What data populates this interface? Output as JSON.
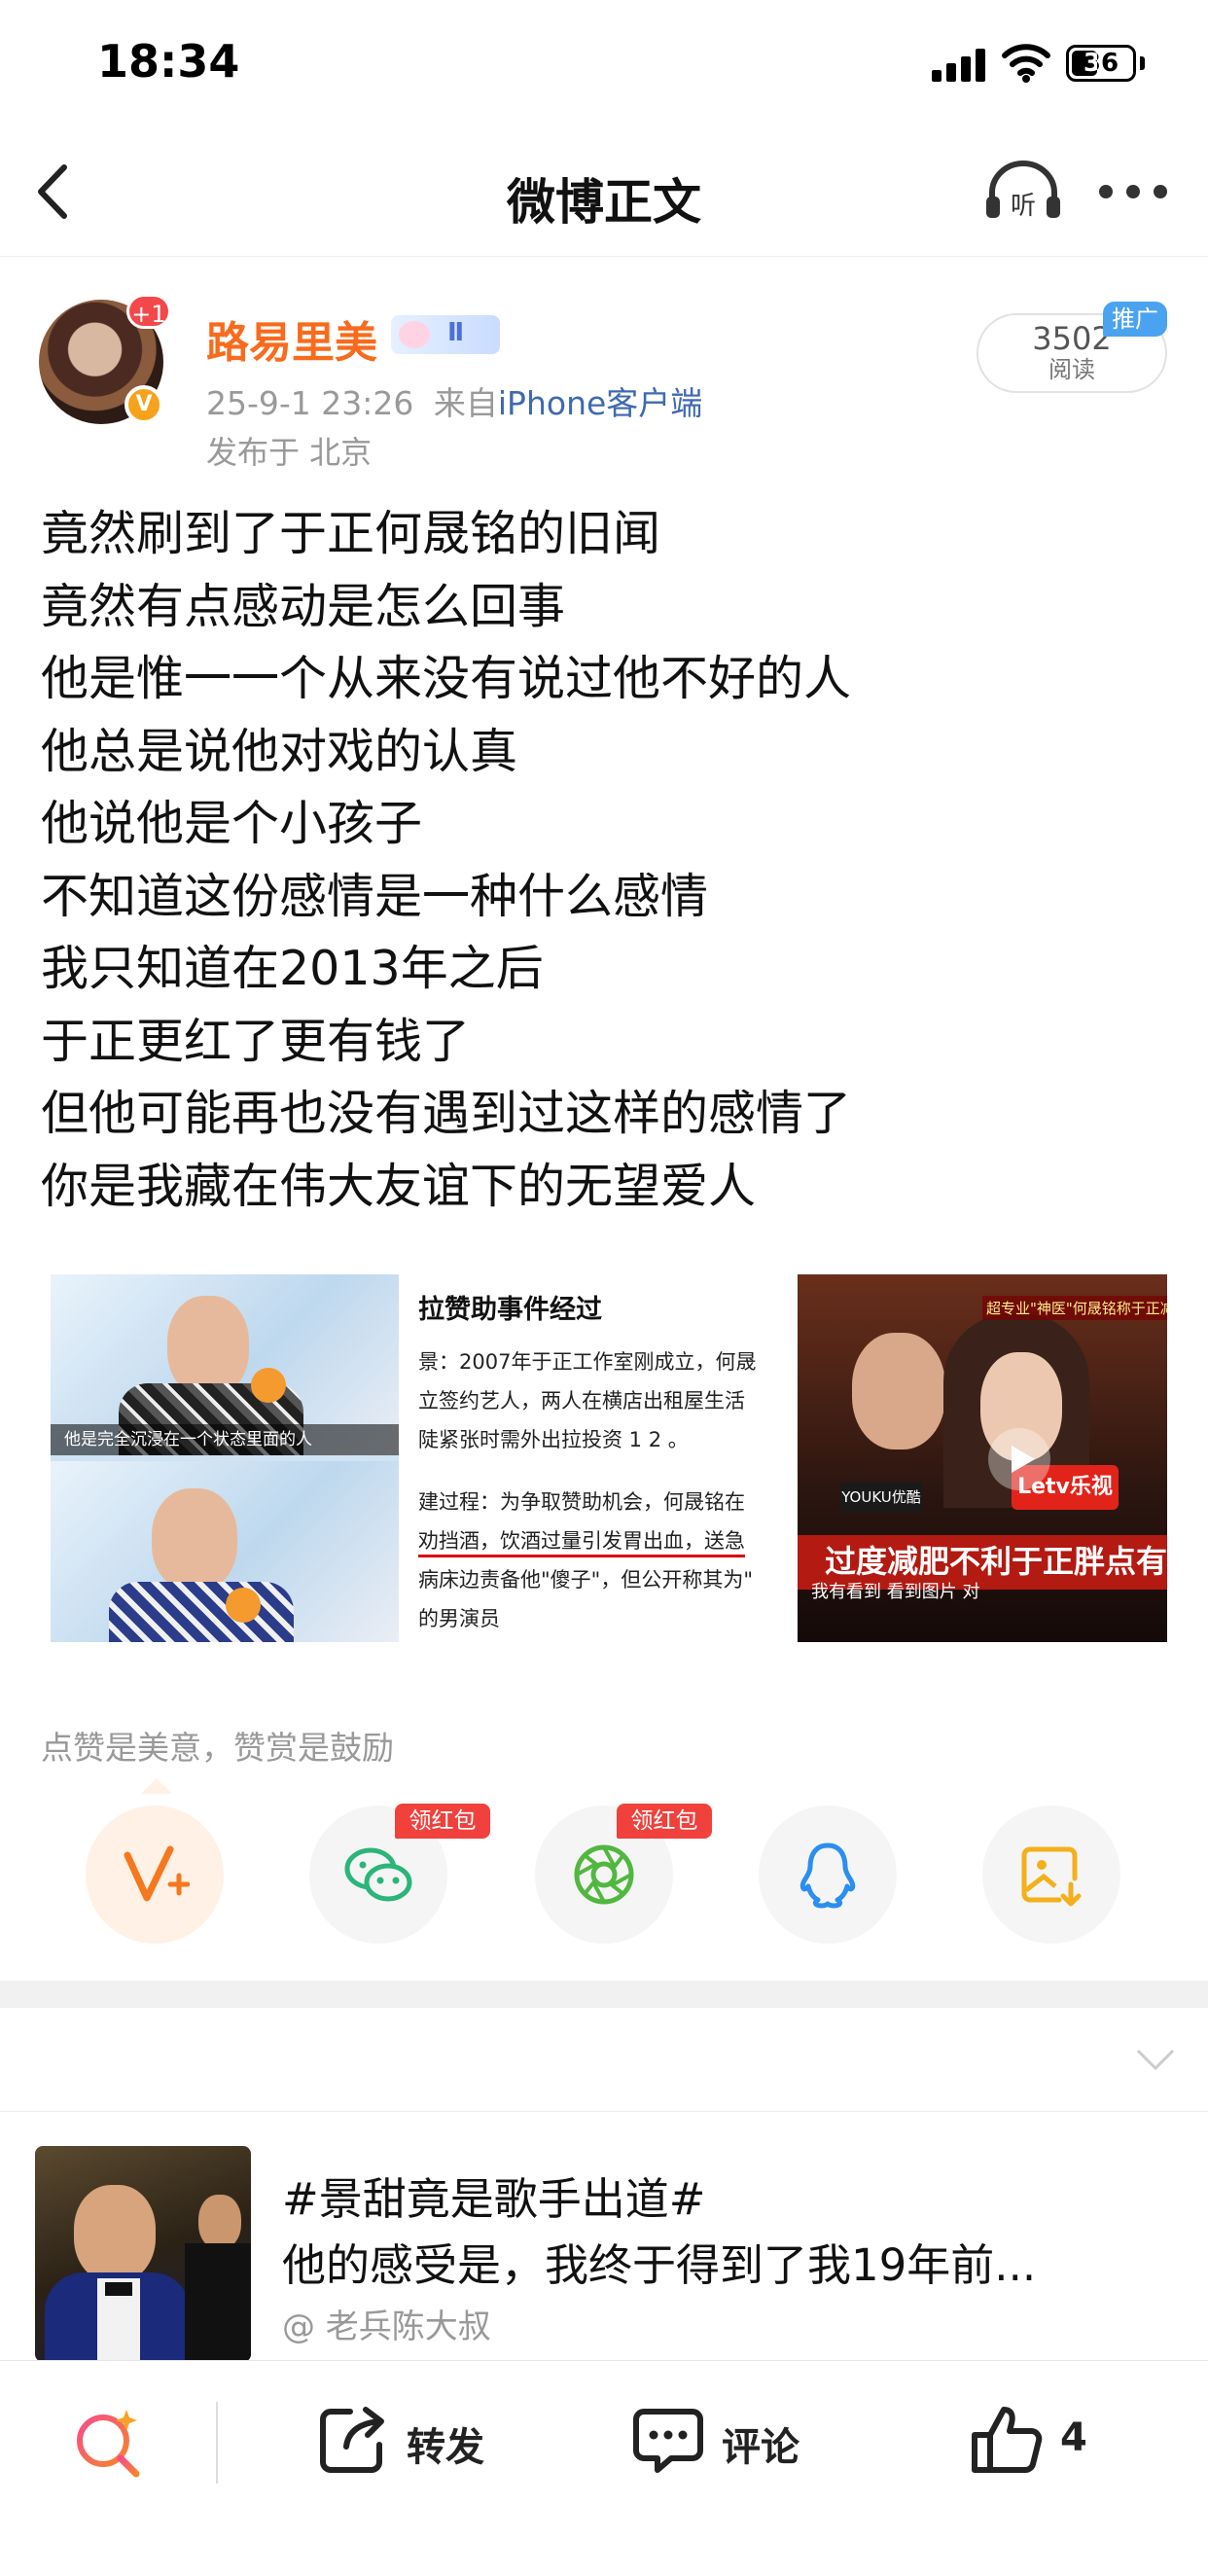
{
  "status_bar": {
    "time": "18:34",
    "battery": "36"
  },
  "nav": {
    "title": "微博正文"
  },
  "post": {
    "author": {
      "name": "路易里美",
      "avatar_badge": "+1",
      "verified_icon": "v-badge",
      "member_level": "Ⅱ"
    },
    "timestamp": "25-9-1 23:26",
    "source_prefix": "来自",
    "source": "iPhone客户端",
    "location": "发布于 北京",
    "read_count": "3502",
    "read_label": "阅读",
    "promo_tag": "推广",
    "lines": [
      "竟然刷到了于正何晟铭的旧闻",
      "竟然有点感动是怎么回事",
      "他是惟一一个从来没有说过他不好的人",
      "他总是说他对戏的认真",
      "他说他是个小孩子",
      "不知道这份感情是一种什么感情",
      "我只知道在2013年之后",
      "于正更红了更有钱了",
      "但他可能再也没有遇到过这样的感情了",
      "你是我藏在伟大友谊下的无望爱人"
    ],
    "images": {
      "img1_caption": "他是完全沉浸在一个状态里面的人",
      "img2_heading": "拉赞助事件经过",
      "img2_lines": [
        "景：2007年于正工作室刚成立，何晟",
        "立签约艺人，两人在横店出租屋生活",
        "陡紧张时需外出拉投资 1 2 。",
        "建过程：为争取赞助机会，何晟铭在",
        "劝挡酒，饮酒过量引发胃出血，送急",
        "病床边责备他\"傻子\"，但公开称其为\"",
        "的男演员"
      ],
      "img3_top": "超专业\"神医\"何晟铭称于正减",
      "img3_logo1": "YOUKU优酷",
      "img3_logo2": "Letv乐视",
      "img3_subtitle": "过度减肥不利于正胖点有福气",
      "img3_small": "我有看到 看到图片 对"
    }
  },
  "reward": {
    "hint": "点赞是美意，赞赏是鼓励",
    "red_packet_label": "领红包",
    "buttons": [
      {
        "icon": "reward-icon"
      },
      {
        "icon": "wechat-icon"
      },
      {
        "icon": "moments-icon"
      },
      {
        "icon": "qq-icon"
      },
      {
        "icon": "save-image-icon"
      }
    ]
  },
  "recommended": {
    "title": "#景甜竟是歌手出道#",
    "subtitle": "他的感受是，我终于得到了我19年前...",
    "author": "@ 老兵陈大叔"
  },
  "bottom_bar": {
    "repost_label": "转发",
    "comment_label": "评论",
    "like_count": "4"
  },
  "colors": {
    "accent_orange": "#f86b1d",
    "red_tag": "#f0413c",
    "link_blue": "#3d6ab0"
  }
}
